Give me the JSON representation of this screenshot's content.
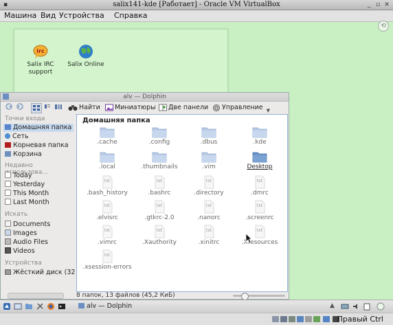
{
  "vbox": {
    "title": "salix141-kde [Работает] - Oracle VM VirtualBox",
    "menu": [
      "Машина",
      "Вид",
      "Устройства",
      "Справка"
    ],
    "host_key": "Правый Ctrl"
  },
  "desktop": {
    "icons": [
      {
        "label": "Salix IRC support",
        "icon": "irc-icon"
      },
      {
        "label": "Salix Online",
        "icon": "globe-icon"
      }
    ]
  },
  "dolphin": {
    "title": "alv — Dolphin",
    "toolbar": {
      "find": "Найти",
      "preview": "Миниатюры",
      "split": "Две панели",
      "control": "Управление"
    },
    "places": {
      "points_header": "Точки входа",
      "points": [
        {
          "label": "Домашняя папка",
          "color": "#5a84c9",
          "active": true
        },
        {
          "label": "Сеть",
          "color": "#4c8fd1"
        },
        {
          "label": "Корневая папка",
          "color": "#b31d1d"
        },
        {
          "label": "Корзина",
          "color": "#6f8fbf"
        }
      ],
      "recent_header": "Недавно использова...",
      "recent": [
        "Today",
        "Yesterday",
        "This Month",
        "Last Month"
      ],
      "search_header": "Искать",
      "search": [
        "Documents",
        "Images",
        "Audio Files",
        "Videos"
      ],
      "devices_header": "Устройства",
      "devices": [
        "Жёсткий диск (32,"
      ]
    },
    "breadcrumb": "Домашняя папка",
    "folders": [
      ".cache",
      ".config",
      ".dbus",
      ".kde",
      ".local",
      ".thumbnails",
      ".vim",
      "Desktop"
    ],
    "files": [
      ".bash_history",
      ".bashrc",
      ".directory",
      ".dmrc",
      ".elvisrc",
      ".gtkrc-2.0",
      ".nanorc",
      ".screenrc",
      ".vimrc",
      ".Xauthority",
      ".xinitrc",
      ".Xresources",
      ".xsession-errors"
    ],
    "file_badge": "txt",
    "status": "8 папок, 13 файлов (45,2 КиБ)"
  },
  "panel": {
    "task": "alv — Dolphin"
  }
}
